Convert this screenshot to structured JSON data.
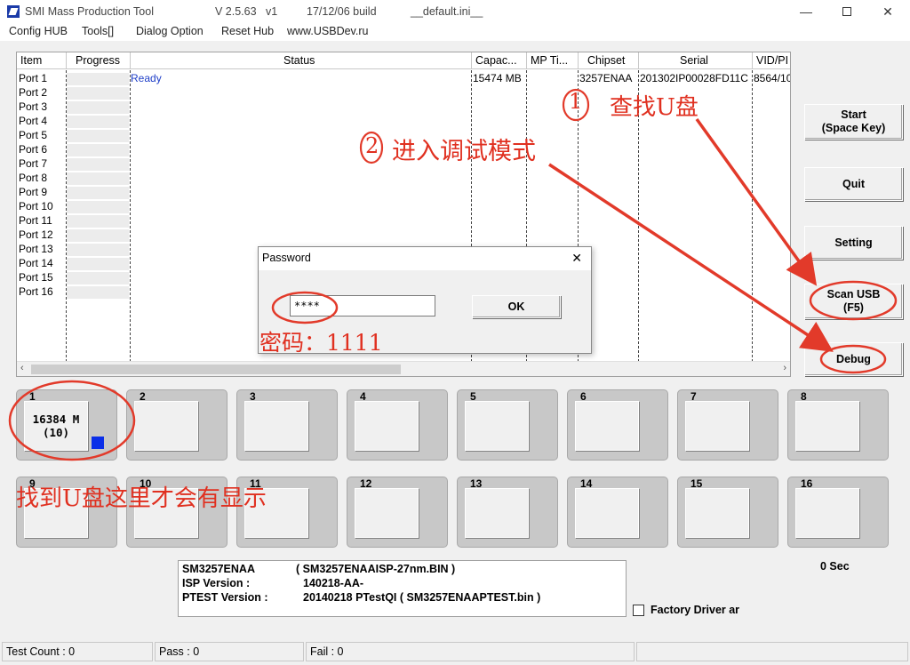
{
  "window": {
    "app_title": "SMI Mass Production Tool",
    "version": "V 2.5.63   v1",
    "build": "17/12/06 build",
    "ini_file": "__default.ini__"
  },
  "menu": [
    "Config HUB",
    "Tools[]",
    "Dialog Option",
    "Reset Hub",
    "www.USBDev.ru"
  ],
  "grid": {
    "columns": [
      "Item",
      "Progress",
      "Status",
      "Capac...",
      "MP Ti...",
      "Chipset",
      "Serial",
      "VID/PI"
    ],
    "ports": [
      "Port 1",
      "Port 2",
      "Port 3",
      "Port 4",
      "Port 5",
      "Port 6",
      "Port 7",
      "Port 8",
      "Port 9",
      "Port 10",
      "Port 11",
      "Port 12",
      "Port 13",
      "Port 14",
      "Port 15",
      "Port 16"
    ],
    "row1": {
      "status": "Ready",
      "capacity": "15474 MB",
      "chipset": "3257ENAA",
      "serial": "201302IP00028FD11C",
      "vid": "8564/10"
    }
  },
  "buttons": {
    "start": "Start\n(Space Key)",
    "quit": "Quit",
    "setting": "Setting",
    "scan": "Scan USB\n(F5)",
    "debug": "Debug"
  },
  "port_boxes": [
    "1",
    "2",
    "3",
    "4",
    "5",
    "6",
    "7",
    "8",
    "9",
    "10",
    "11",
    "12",
    "13",
    "14",
    "15",
    "16"
  ],
  "port1_capacity": "16384 M",
  "port1_count": "(10)",
  "info": {
    "chip": "SM3257ENAA",
    "chip_bin": "( SM3257ENAAISP-27nm.BIN )",
    "isp_label": "ISP Version :",
    "isp_value": "140218-AA-",
    "ptest_label": "PTEST Version :",
    "ptest_value": "20140218 PTestQI ( SM3257ENAAPTEST.bin )"
  },
  "timer": "0 Sec",
  "factory_driver": "Factory Driver ar",
  "status_bar": {
    "test_count": "Test Count : 0",
    "pass": "Pass : 0",
    "fail": "Fail : 0"
  },
  "dialog": {
    "title": "Password",
    "password_value": "****",
    "ok": "OK"
  },
  "annotations": {
    "step1_num": "1",
    "step1_text": "查找U盘",
    "step2_num": "2",
    "step2_text": "进入调试模式",
    "password_hint": "密码：1111",
    "found_hint": "找到U盘这里才会有显示"
  },
  "colors": {
    "annotation_red": "#e23a2a",
    "ready_blue": "#1f3fc8",
    "port1_indicator": "#0a2ee8"
  }
}
